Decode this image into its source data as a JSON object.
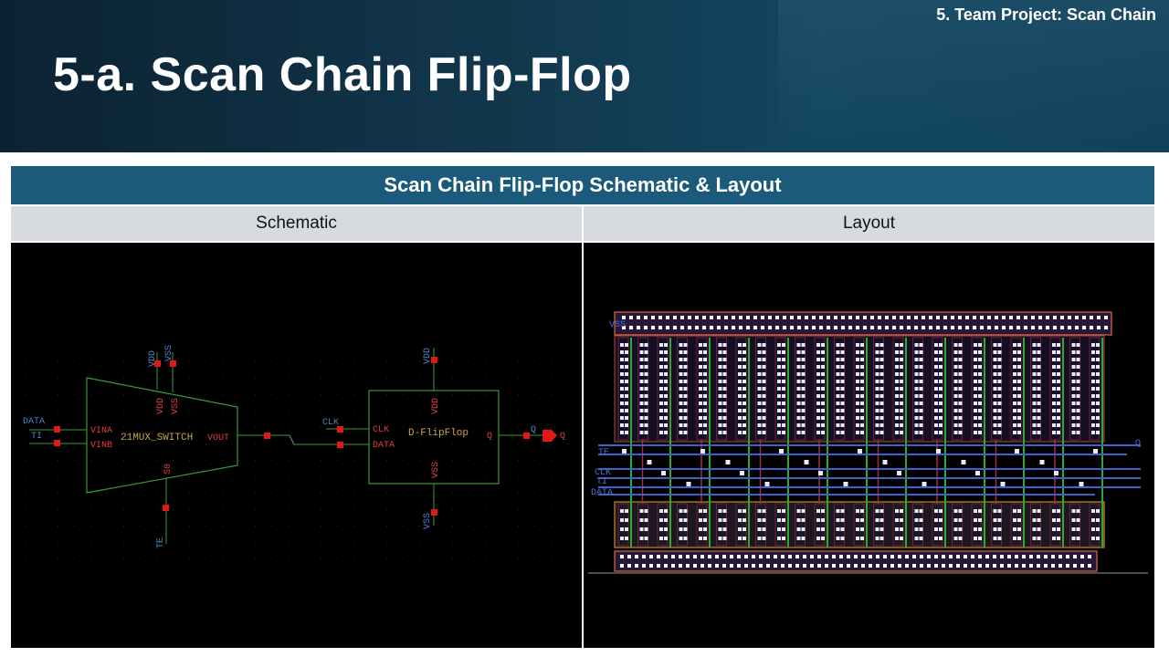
{
  "header": {
    "section_label": "5. Team Project: Scan Chain",
    "title": "5-a. Scan Chain Flip-Flop"
  },
  "table": {
    "title": "Scan Chain Flip-Flop Schematic & Layout",
    "columns": [
      "Schematic",
      "Layout"
    ]
  },
  "schematic": {
    "mux_label": "21MUX_SWITCH",
    "mux_pins": {
      "vina": "VINA",
      "vinb": "VINB",
      "vout": "VOUT",
      "vdd": "VDD",
      "vss": "VSS",
      "s0": "S0"
    },
    "mux_top_nets": {
      "vdd": "VDD",
      "vss": "VSS"
    },
    "left_nets": {
      "data": "DATA",
      "ti": "TI"
    },
    "te_net": "TE",
    "dff_label": "D-FlipFlop",
    "dff_pins": {
      "clk": "CLK",
      "data": "DATA",
      "q": "Q",
      "vdd": "VDD",
      "vss": "VSS"
    },
    "clk_net": "CLK",
    "dff_top_net": "VDD",
    "dff_bottom_net": "VSS",
    "q_net": "Q",
    "q_port": "Q"
  },
  "layout": {
    "labels": {
      "vss": "VSS",
      "te": "TE",
      "clk": "CLK",
      "ti": "TI",
      "data": "DATA",
      "q": "Q"
    }
  },
  "colors": {
    "header_bg": "#12384e",
    "table_title_bg": "#1c5a7c",
    "column_header_bg": "#d7dade",
    "wire_green": "#3a9a3a",
    "pin_red": "#e01818",
    "net_blue": "#4f82c8"
  }
}
